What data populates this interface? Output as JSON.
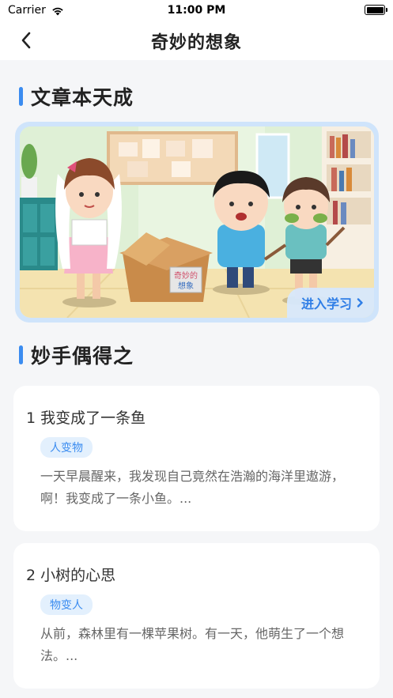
{
  "status": {
    "carrier": "Carrier",
    "time": "11:00 PM"
  },
  "nav": {
    "title": "奇妙的想象"
  },
  "section1": {
    "title": "文章本天成"
  },
  "banner": {
    "box_label_line1": "奇妙的",
    "box_label_line2": "想象",
    "enter_label": "进入学习"
  },
  "section2": {
    "title": "妙手偶得之"
  },
  "articles": [
    {
      "title": "1 我变成了一条鱼",
      "tag": "人变物",
      "desc": "一天早晨醒来，我发现自己竟然在浩瀚的海洋里遨游，啊！我变成了一条小鱼。..."
    },
    {
      "title": "2 小树的心思",
      "tag": "物变人",
      "desc": "从前，森林里有一棵苹果树。有一天，他萌生了一个想法。..."
    }
  ]
}
